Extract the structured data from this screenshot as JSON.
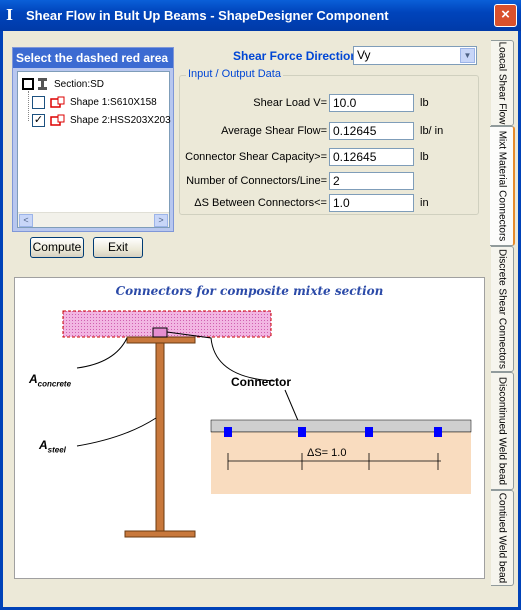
{
  "window": {
    "title": "Shear Flow in Bult Up Beams - ShapeDesigner Component",
    "close": "×",
    "icon": "I"
  },
  "panel": {
    "header": "Select the dashed red area",
    "tree": [
      {
        "label": "Section:SD",
        "checked": false
      },
      {
        "label": "Shape 1:S610X158",
        "checked": false
      },
      {
        "label": "Shape 2:HSS203X203",
        "checked": true
      }
    ],
    "check_mark": "✓",
    "scroll_left": "<",
    "scroll_right": ">"
  },
  "buttons": {
    "compute": "Compute",
    "exit": "Exit"
  },
  "direction": {
    "label": "Shear Force Direction:",
    "value": "Vy",
    "arrow": "▼"
  },
  "io": {
    "group_title": "Input / Output Data",
    "rows": [
      {
        "label": "Shear Load V=",
        "value": "10.0",
        "unit": "lb"
      },
      {
        "label": "Average Shear Flow=",
        "value": "0.12645",
        "unit": "lb/ in"
      },
      {
        "label": "Connector Shear Capacity>=",
        "value": "0.12645",
        "unit": "lb"
      },
      {
        "label": "Number of Connectors/Line=",
        "value": "2",
        "unit": ""
      },
      {
        "label": "ΔS  Between Connectors<=",
        "value": "1.0",
        "unit": "in"
      }
    ]
  },
  "tabs": [
    {
      "label": "Loacal Shear Flow",
      "active": false
    },
    {
      "label": "Mixt Material Connectors",
      "active": true
    },
    {
      "label": "Discrete Shear Connectors",
      "active": false
    },
    {
      "label": "Discontinued Weld bead",
      "active": false
    },
    {
      "label": "Contiued Weld bead",
      "active": false
    }
  ],
  "diagram": {
    "title": "Connectors for composite mixte section",
    "a_concrete": {
      "main": "A",
      "sub": "concrete"
    },
    "a_steel": {
      "main": "A",
      "sub": "steel"
    },
    "connector_label": "Connector",
    "spacing_label": "ΔS= 1.0",
    "colors": {
      "concrete": "#e9a8d8",
      "steel": "#c8783c",
      "slab": "#f9dcbf",
      "connector": "#0000ff"
    }
  }
}
